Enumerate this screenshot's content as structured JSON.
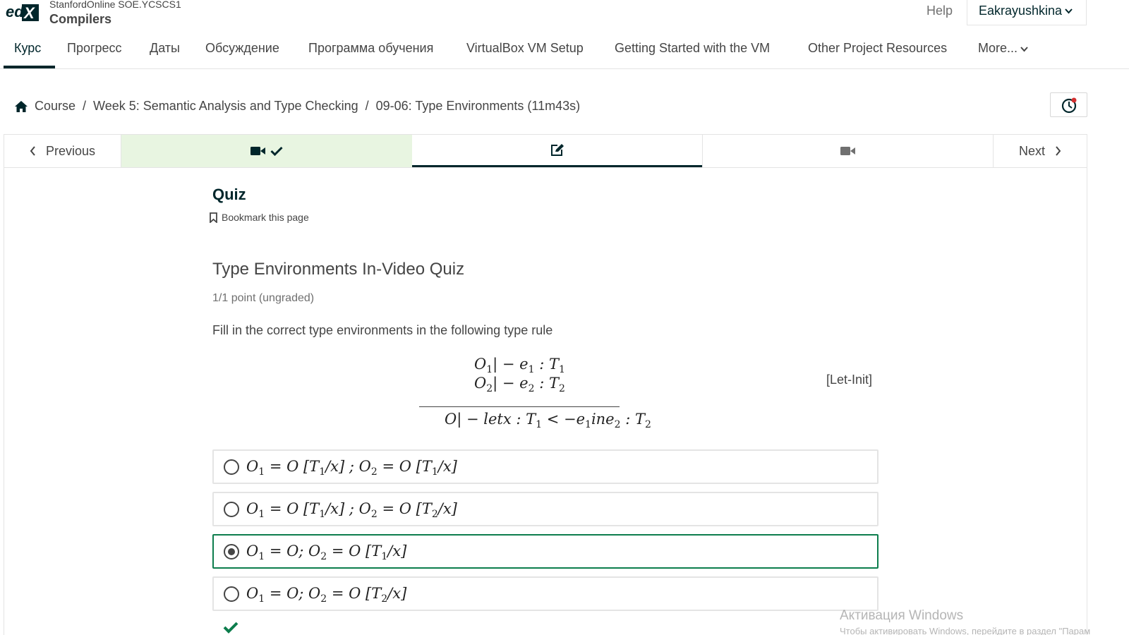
{
  "header": {
    "logo_text": "edX",
    "course_org": "StanfordOnline SOE.YCSCS1",
    "course_title": "Compilers",
    "help_label": "Help",
    "username": "Eakrayushkina"
  },
  "nav": {
    "tabs": [
      {
        "label": "Курс",
        "active": true
      },
      {
        "label": "Прогресс"
      },
      {
        "label": "Даты"
      },
      {
        "label": "Обсуждение"
      },
      {
        "label": "Программа обучения"
      },
      {
        "label": "VirtualBox VM Setup"
      },
      {
        "label": "Getting Started with the VM"
      },
      {
        "label": "Other Project Resources"
      },
      {
        "label": "More..."
      }
    ]
  },
  "breadcrumb": {
    "items": [
      "Course",
      "Week 5: Semantic Analysis and Type Checking",
      "09-06: Type Environments (11m43s)"
    ],
    "separator": "/"
  },
  "sequence": {
    "previous_label": "Previous",
    "next_label": "Next",
    "units": [
      {
        "type": "video",
        "status": "complete"
      },
      {
        "type": "problem",
        "status": "current"
      },
      {
        "type": "video",
        "status": "upcoming"
      }
    ],
    "complete_color": "#e8f5e1"
  },
  "unit": {
    "title": "Quiz",
    "bookmark_label": "Bookmark this page"
  },
  "problem": {
    "title": "Type Environments In-Video Quiz",
    "progress": "1/1 point (ungraded)",
    "question": "Fill in the correct type environments in the following type rule",
    "rule_label": "[Let-Init]",
    "choices": [
      {
        "text": "O1 = O [T1/x] ; O2 = O [T1/x]",
        "selected": false
      },
      {
        "text": "O1 = O [T1/x] ; O2 = O [T2/x]",
        "selected": false
      },
      {
        "text": "O1 = O; O2 = O [T1/x]",
        "selected": true
      },
      {
        "text": "O1 = O; O2 = O [T2/x]",
        "selected": false
      }
    ],
    "result": "correct",
    "selected_color": "#0d7d4d"
  },
  "watermark": {
    "title": "Активация Windows",
    "subtitle": "Чтобы активировать Windows, перейдите в раздел \"Парам"
  }
}
